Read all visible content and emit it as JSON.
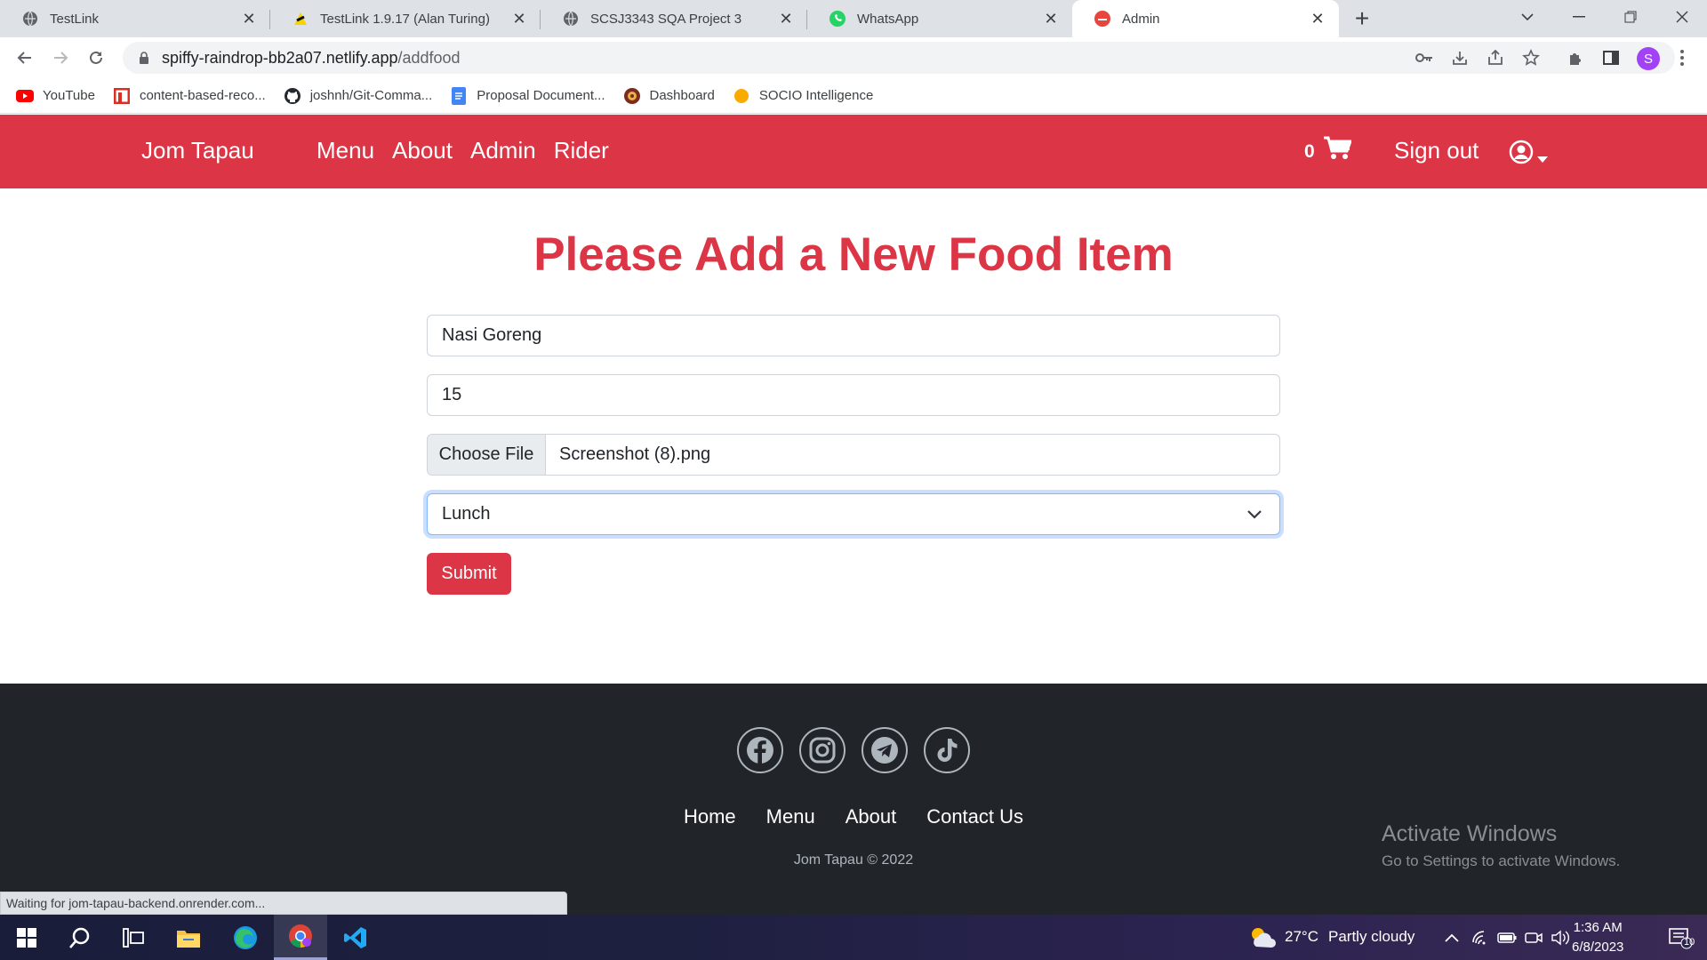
{
  "browser": {
    "tabs": [
      {
        "title": "TestLink",
        "icon": "globe-icon"
      },
      {
        "title": "TestLink 1.9.17 (Alan Turing)",
        "icon": "testlink-icon"
      },
      {
        "title": "SCSJ3343 SQA Project 3",
        "icon": "globe-icon"
      },
      {
        "title": "WhatsApp",
        "icon": "whatsapp-icon"
      },
      {
        "title": "Admin",
        "icon": "site-icon",
        "active": true
      }
    ],
    "url_host": "spiffy-raindrop-bb2a07.netlify.app",
    "url_path": "/addfood",
    "profile_initial": "S",
    "bookmarks": [
      {
        "label": "YouTube",
        "icon": "youtube-icon"
      },
      {
        "label": "content-based-reco...",
        "icon": "bookmark-icon"
      },
      {
        "label": "joshnh/Git-Comma...",
        "icon": "github-icon"
      },
      {
        "label": "Proposal Document...",
        "icon": "docs-icon"
      },
      {
        "label": "Dashboard",
        "icon": "dashboard-icon"
      },
      {
        "label": "SOCIO Intelligence",
        "icon": "socio-icon"
      }
    ],
    "status_text": "Waiting for jom-tapau-backend.onrender.com..."
  },
  "navbar": {
    "brand": "Jom Tapau",
    "links": [
      "Menu",
      "About",
      "Admin",
      "Rider"
    ],
    "cart_count": "0",
    "sign_out": "Sign out"
  },
  "form": {
    "heading": "Please Add a New Food Item",
    "name_value": "Nasi Goreng",
    "price_value": "15",
    "file_button": "Choose File",
    "file_name": "Screenshot (8).png",
    "category_value": "Lunch",
    "submit_label": "Submit"
  },
  "footer": {
    "socials": [
      "facebook-icon",
      "instagram-icon",
      "telegram-icon",
      "tiktok-icon"
    ],
    "links": [
      "Home",
      "Menu",
      "About",
      "Contact Us"
    ],
    "copyright": "Jom Tapau © 2022",
    "watermark_title": "Activate Windows",
    "watermark_sub": "Go to Settings to activate Windows."
  },
  "taskbar": {
    "weather": "27°C",
    "weather_desc": "Partly cloudy",
    "time": "1:36 AM",
    "date": "6/8/2023",
    "notification_count": "10"
  },
  "colors": {
    "brand_red": "#dc3545",
    "footer_bg": "#212529"
  }
}
